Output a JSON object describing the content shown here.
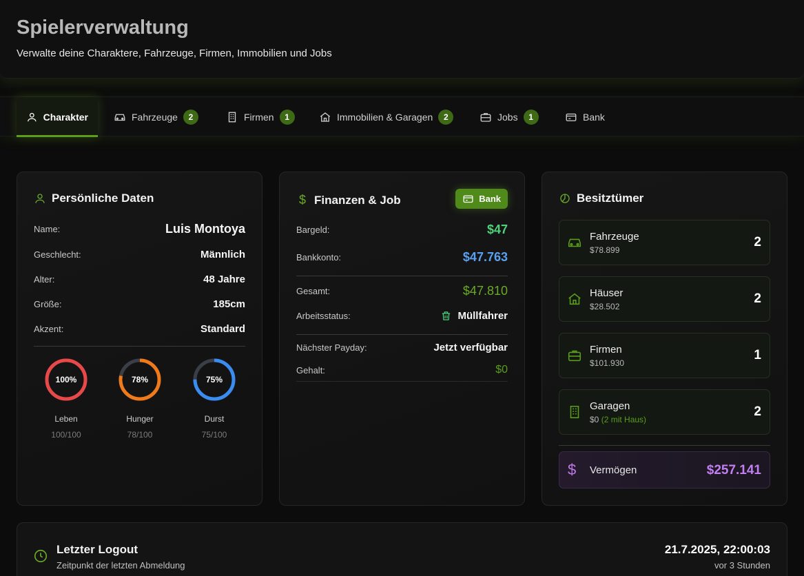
{
  "header": {
    "title": "Spielerverwaltung",
    "subtitle": "Verwalte deine Charaktere, Fahrzeuge, Firmen, Immobilien und Jobs"
  },
  "tabs": [
    {
      "label": "Charakter",
      "badge": ""
    },
    {
      "label": "Fahrzeuge",
      "badge": "2"
    },
    {
      "label": "Firmen",
      "badge": "1"
    },
    {
      "label": "Immobilien & Garagen",
      "badge": "2"
    },
    {
      "label": "Jobs",
      "badge": "1"
    },
    {
      "label": "Bank",
      "badge": ""
    }
  ],
  "personal": {
    "title": "Persönliche Daten",
    "rows": [
      {
        "label": "Name:",
        "value": "Luis Montoya"
      },
      {
        "label": "Geschlecht:",
        "value": "Männlich"
      },
      {
        "label": "Alter:",
        "value": "48 Jahre"
      },
      {
        "label": "Größe:",
        "value": "185cm"
      },
      {
        "label": "Akzent:",
        "value": "Standard"
      }
    ],
    "stats": [
      {
        "pct_text": "100%",
        "fraction": 1.0,
        "label": "Leben",
        "sub": "100/100",
        "color": "#e84848"
      },
      {
        "pct_text": "78%",
        "fraction": 0.78,
        "label": "Hunger",
        "sub": "78/100",
        "color": "#f07a1a"
      },
      {
        "pct_text": "75%",
        "fraction": 0.75,
        "label": "Durst",
        "sub": "75/100",
        "color": "#3a8cf0"
      }
    ]
  },
  "finance": {
    "title": "Finanzen & Job",
    "bank_button": "Bank",
    "cash_label": "Bargeld:",
    "cash": "$47",
    "bank_label": "Bankkonto:",
    "bank": "$47.763",
    "total_label": "Gesamt:",
    "total": "$47.810",
    "job_label": "Arbeitsstatus:",
    "job": "Müllfahrer",
    "payday_label": "Nächster Payday:",
    "payday": "Jetzt verfügbar",
    "salary_label": "Gehalt:",
    "salary": "$0"
  },
  "assets": {
    "title": "Besitztümer",
    "items": [
      {
        "name": "Fahrzeuge",
        "value": "$78.899",
        "note": "",
        "count": "2"
      },
      {
        "name": "Häuser",
        "value": "$28.502",
        "note": "",
        "count": "2"
      },
      {
        "name": "Firmen",
        "value": "$101.930",
        "note": "",
        "count": "1"
      },
      {
        "name": "Garagen",
        "value": "$0",
        "note": "(2 mit Haus)",
        "count": "2"
      }
    ],
    "worth_label": "Vermögen",
    "worth": "$257.141"
  },
  "logout": {
    "title": "Letzter Logout",
    "subtitle": "Zeitpunkt der letzten Abmeldung",
    "datetime": "21.7.2025, 22:00:03",
    "relative": "vor 3 Stunden"
  },
  "colors": {
    "accent": "#5a9e1a",
    "cash": "#4fd07a",
    "bank": "#5aa0f0",
    "total": "#6aaa28",
    "worth": "#c27ff0"
  }
}
